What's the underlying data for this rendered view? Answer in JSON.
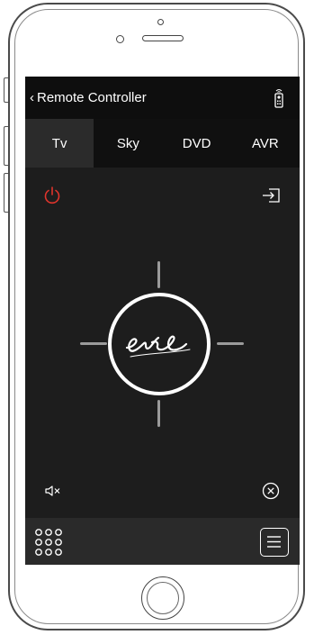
{
  "nav": {
    "back_label": "Remote Controller",
    "back_chevron": "‹",
    "right_icon": "remote-icon"
  },
  "tabs": [
    {
      "label": "Tv",
      "active": true
    },
    {
      "label": "Sky",
      "active": false
    },
    {
      "label": "DVD",
      "active": false
    },
    {
      "label": "AVR",
      "active": false
    }
  ],
  "controls": {
    "power_icon": "power-icon",
    "input_icon": "input-source-icon",
    "mute_icon": "mute-icon",
    "close_icon": "close-circle-icon",
    "center_logo": "eve-logo",
    "keypad_icon": "keypad-icon",
    "menu_icon": "menu-icon"
  },
  "colors": {
    "screen_bg": "#1d1d1d",
    "nav_bg": "#0e0e0e",
    "active_tab_bg": "#2b2b2b",
    "power_red": "#e0342c",
    "bottom_bar_bg": "#2a2a2a"
  }
}
